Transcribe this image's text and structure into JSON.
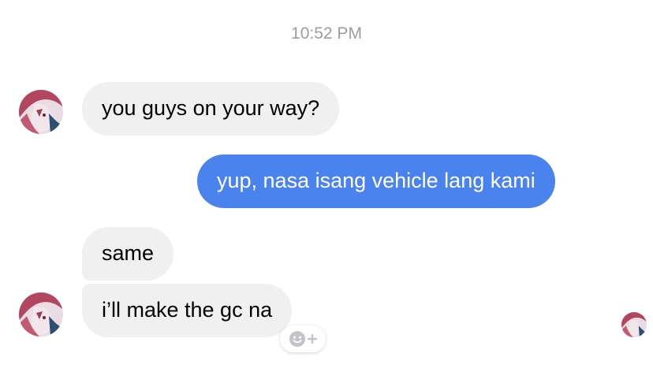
{
  "timestamp": "10:52 PM",
  "messages": [
    {
      "direction": "incoming",
      "text": "you guys on your way?"
    },
    {
      "direction": "outgoing",
      "text": "yup, nasa isang vehicle lang kami"
    },
    {
      "direction": "incoming",
      "text": "same"
    },
    {
      "direction": "incoming",
      "text": "i’ll make the gc na"
    }
  ],
  "icons": {
    "avatar": "anime-avatar-icon",
    "reaction": "add-reaction-icon",
    "seen": "seen-avatar-icon"
  },
  "colors": {
    "outgoing_bubble": "#4a82ee",
    "incoming_bubble": "#f0f0f0",
    "timestamp": "#9d9da1"
  }
}
